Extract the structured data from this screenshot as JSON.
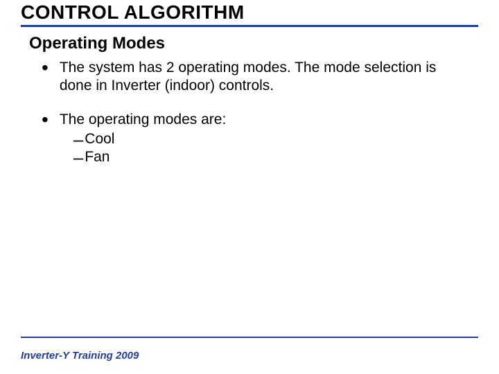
{
  "title": "CONTROL ALGORITHM",
  "subtitle": "Operating Modes",
  "bullets": [
    {
      "text": "The system has 2 operating modes. The mode selection is done in Inverter (indoor) controls."
    },
    {
      "text": "The operating modes are:",
      "subitems": [
        "Cool",
        "Fan"
      ]
    }
  ],
  "footer": "Inverter-Y Training 2009"
}
